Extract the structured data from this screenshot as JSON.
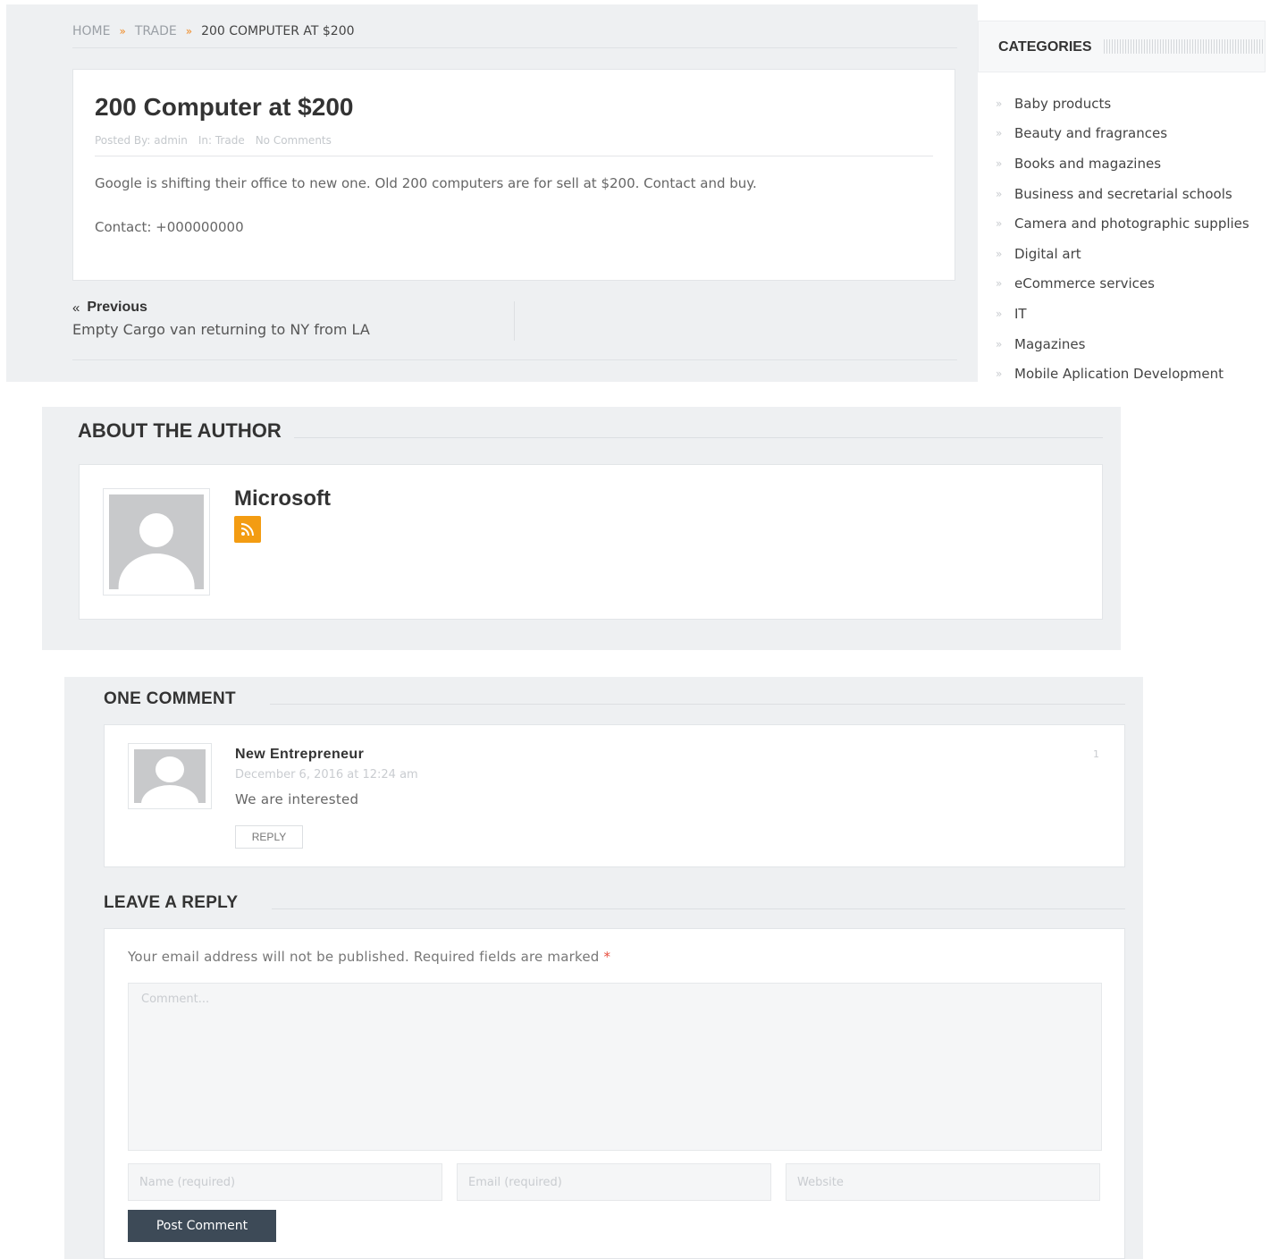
{
  "breadcrumb": {
    "home": "HOME",
    "trade": "TRADE",
    "current": "200 COMPUTER AT $200"
  },
  "post": {
    "title": "200 Computer at $200",
    "meta": {
      "posted_by": "Posted By: admin",
      "category": "In: Trade",
      "comments": "No Comments"
    },
    "body": "Google is shifting their office to new one. Old 200 computers are for sell at $200. Contact and buy.",
    "contact": "Contact: +000000000"
  },
  "nav": {
    "previous_label": "Previous",
    "previous_title": "Empty Cargo van returning to NY from LA"
  },
  "sidebar": {
    "title": "CATEGORIES",
    "items": [
      "Baby products",
      "Beauty and fragrances",
      "Books and magazines",
      "Business and secretarial schools",
      "Camera and photographic supplies",
      "Digital art",
      "eCommerce services",
      "IT",
      "Magazines",
      "Mobile Aplication Development"
    ]
  },
  "author": {
    "section_title": "ABOUT THE AUTHOR",
    "name": "Microsoft",
    "rss_icon": "rss-icon"
  },
  "comments": {
    "section_title": "ONE COMMENT",
    "items": [
      {
        "author": "New Entrepreneur",
        "date": "December 6, 2016 at 12:24 am",
        "text": "We are interested",
        "number": "1",
        "reply_label": "REPLY"
      }
    ]
  },
  "reply": {
    "section_title": "LEAVE A REPLY",
    "notice": "Your email address will not be published. Required fields are marked",
    "required_mark": "*",
    "comment_placeholder": "Comment...",
    "name_placeholder": "Name (required)",
    "email_placeholder": "Email (required)",
    "website_placeholder": "Website",
    "submit_label": "Post Comment"
  },
  "colors": {
    "accent": "#f08a24",
    "rss": "#f39c12",
    "button_dark": "#3d4a57",
    "required": "#e74c3c"
  }
}
